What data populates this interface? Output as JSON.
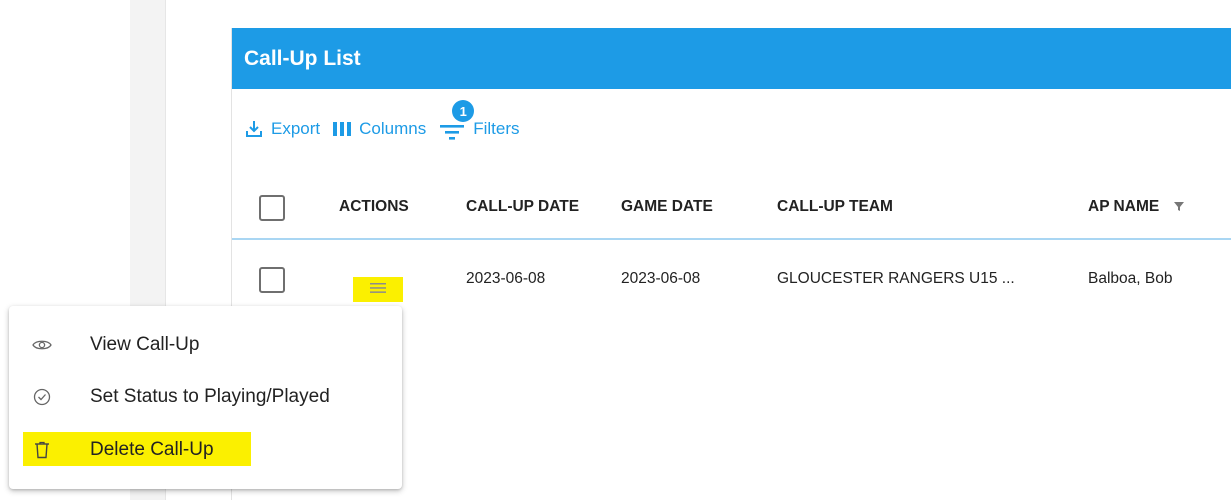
{
  "card": {
    "title": "Call-Up List"
  },
  "toolbar": {
    "export_label": "Export",
    "columns_label": "Columns",
    "filters_label": "Filters",
    "filter_count": "1"
  },
  "table": {
    "columns": [
      "ACTIONS",
      "CALL-UP DATE",
      "GAME DATE",
      "CALL-UP TEAM",
      "AP NAME"
    ],
    "rows": [
      {
        "callup_date": "2023-06-08",
        "game_date": "2023-06-08",
        "callup_team": "GLOUCESTER RANGERS U15 ...",
        "ap_name": "Balboa, Bob"
      }
    ]
  },
  "menu": {
    "items": [
      {
        "label": "View Call-Up",
        "icon": "eye-icon"
      },
      {
        "label": "Set Status to Playing/Played",
        "icon": "check-circle-icon"
      },
      {
        "label": "Delete Call-Up",
        "icon": "trash-icon"
      }
    ]
  },
  "colors": {
    "accent": "#1d9be6",
    "highlight": "#fbf000"
  }
}
